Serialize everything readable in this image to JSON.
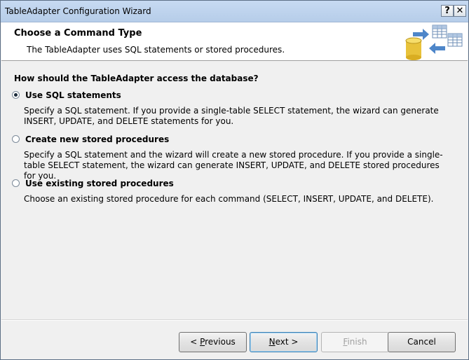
{
  "window": {
    "title": "TableAdapter Configuration Wizard",
    "help_label": "?",
    "close_label": "✕"
  },
  "header": {
    "title": "Choose a Command Type",
    "subtitle": "The TableAdapter uses SQL statements or stored procedures."
  },
  "question": "How should the TableAdapter access the database?",
  "options": [
    {
      "label": "Use SQL statements",
      "selected": true,
      "description": "Specify a SQL statement. If you provide a single-table SELECT statement, the wizard can generate INSERT, UPDATE, and DELETE statements for you."
    },
    {
      "label": "Create new stored procedures",
      "selected": false,
      "description": "Specify a SQL statement and the wizard will create a new stored procedure. If you provide a single-table SELECT statement, the wizard can generate INSERT, UPDATE, and DELETE stored procedures for you."
    },
    {
      "label": "Use existing stored procedures",
      "selected": false,
      "description": "Choose an existing stored procedure for each command (SELECT, INSERT, UPDATE, and DELETE)."
    }
  ],
  "buttons": {
    "previous": {
      "prefix": "< ",
      "mnemonic": "P",
      "rest": "revious"
    },
    "next": {
      "mnemonic": "N",
      "rest": "ext >"
    },
    "finish": {
      "mnemonic": "F",
      "rest": "inish"
    },
    "cancel": "Cancel"
  }
}
